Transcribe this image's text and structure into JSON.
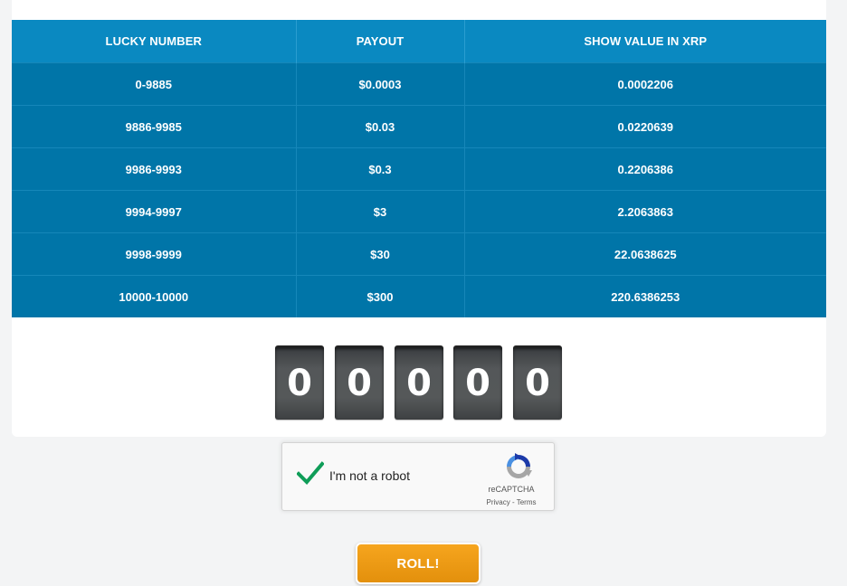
{
  "table": {
    "headers": [
      "LUCKY NUMBER",
      "PAYOUT",
      "SHOW VALUE IN XRP"
    ],
    "rows": [
      [
        "0-9885",
        "$0.0003",
        "0.0002206"
      ],
      [
        "9886-9985",
        "$0.03",
        "0.0220639"
      ],
      [
        "9986-9993",
        "$0.3",
        "0.2206386"
      ],
      [
        "9994-9997",
        "$3",
        "2.2063863"
      ],
      [
        "9998-9999",
        "$30",
        "22.0638625"
      ],
      [
        "10000-10000",
        "$300",
        "220.6386253"
      ]
    ]
  },
  "roll_digits": [
    "0",
    "0",
    "0",
    "0",
    "0"
  ],
  "recaptcha": {
    "label": "I'm not a robot",
    "brand": "reCAPTCHA",
    "privacy": "Privacy",
    "separator": " - ",
    "terms": "Terms",
    "checked": true,
    "check_color": "#0f9d58"
  },
  "roll_button": {
    "label": "ROLL!"
  },
  "colors": {
    "header_bg": "#0a89c1",
    "row_bg": "#0075a8",
    "button_orange": "#f0a01a",
    "page_bg": "#f3f4f5"
  },
  "icons": {
    "check": "checkmark-icon",
    "captcha": "recaptcha-logo-icon"
  }
}
